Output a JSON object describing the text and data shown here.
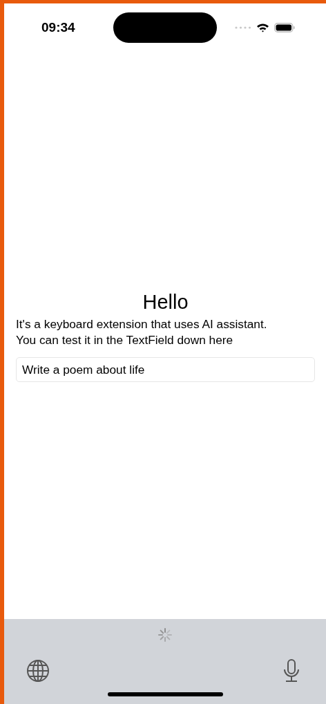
{
  "status_bar": {
    "time": "09:34"
  },
  "title": "Hello",
  "description_lines": [
    "It's a keyboard extension that uses AI assistant.",
    "You can test it in the TextField down here"
  ],
  "text_field": {
    "value": "Write a poem about life"
  }
}
